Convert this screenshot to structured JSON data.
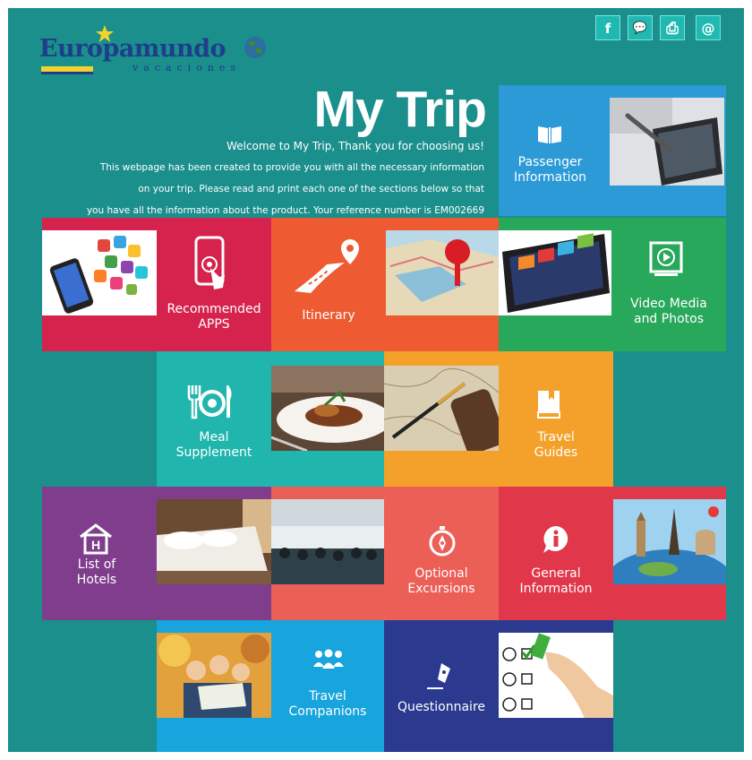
{
  "header": {
    "logo_text": "Europamundo",
    "logo_sub": "vacaciones",
    "title": "My Trip",
    "welcome": "Welcome to My Trip, Thank you for choosing us!",
    "intro_lines": [
      "This webpage has been created to provide you with all the necessary information",
      "on your trip. Please read and print each one of the sections below so that",
      "you have all the information about the product. Your reference number is EM002669"
    ]
  },
  "social": [
    {
      "icon": "facebook-icon",
      "glyph": "f"
    },
    {
      "icon": "chat-icon",
      "glyph": "💬"
    },
    {
      "icon": "print-icon",
      "glyph": "⎙"
    },
    {
      "icon": "email-icon",
      "glyph": "@"
    }
  ],
  "tiles": {
    "passenger": {
      "line1": "Passenger",
      "line2": "Information",
      "color": "#2b9ad7"
    },
    "apps": {
      "line1": "Recommended",
      "line2": "APPS",
      "color": "#d6234e"
    },
    "itinerary": {
      "line1": "Itinerary",
      "color": "#ee5a32"
    },
    "video": {
      "line1": "Video Media",
      "line2": "and Photos",
      "color": "#27a85a"
    },
    "meal": {
      "line1": "Meal",
      "line2": "Supplement",
      "color": "#20b5ad"
    },
    "guides": {
      "line1": "Travel",
      "line2": "Guides",
      "color": "#f4a12c"
    },
    "hotels": {
      "line1": "List of",
      "line2": "Hotels",
      "color": "#7f3d8c"
    },
    "excursions": {
      "line1": "Optional",
      "line2": "Excursions",
      "color": "#ec5f57"
    },
    "general": {
      "line1": "General",
      "line2": "Information",
      "color": "#e0384a"
    },
    "companions": {
      "line1": "Travel",
      "line2": "Companions",
      "color": "#18a4dc"
    },
    "questionnaire": {
      "line1": "Questionnaire",
      "color": "#2b3a8f"
    }
  },
  "colors": {
    "background": "#1a8f8c",
    "logo_blue": "#1f3e8a",
    "logo_yellow": "#f2d22e"
  }
}
